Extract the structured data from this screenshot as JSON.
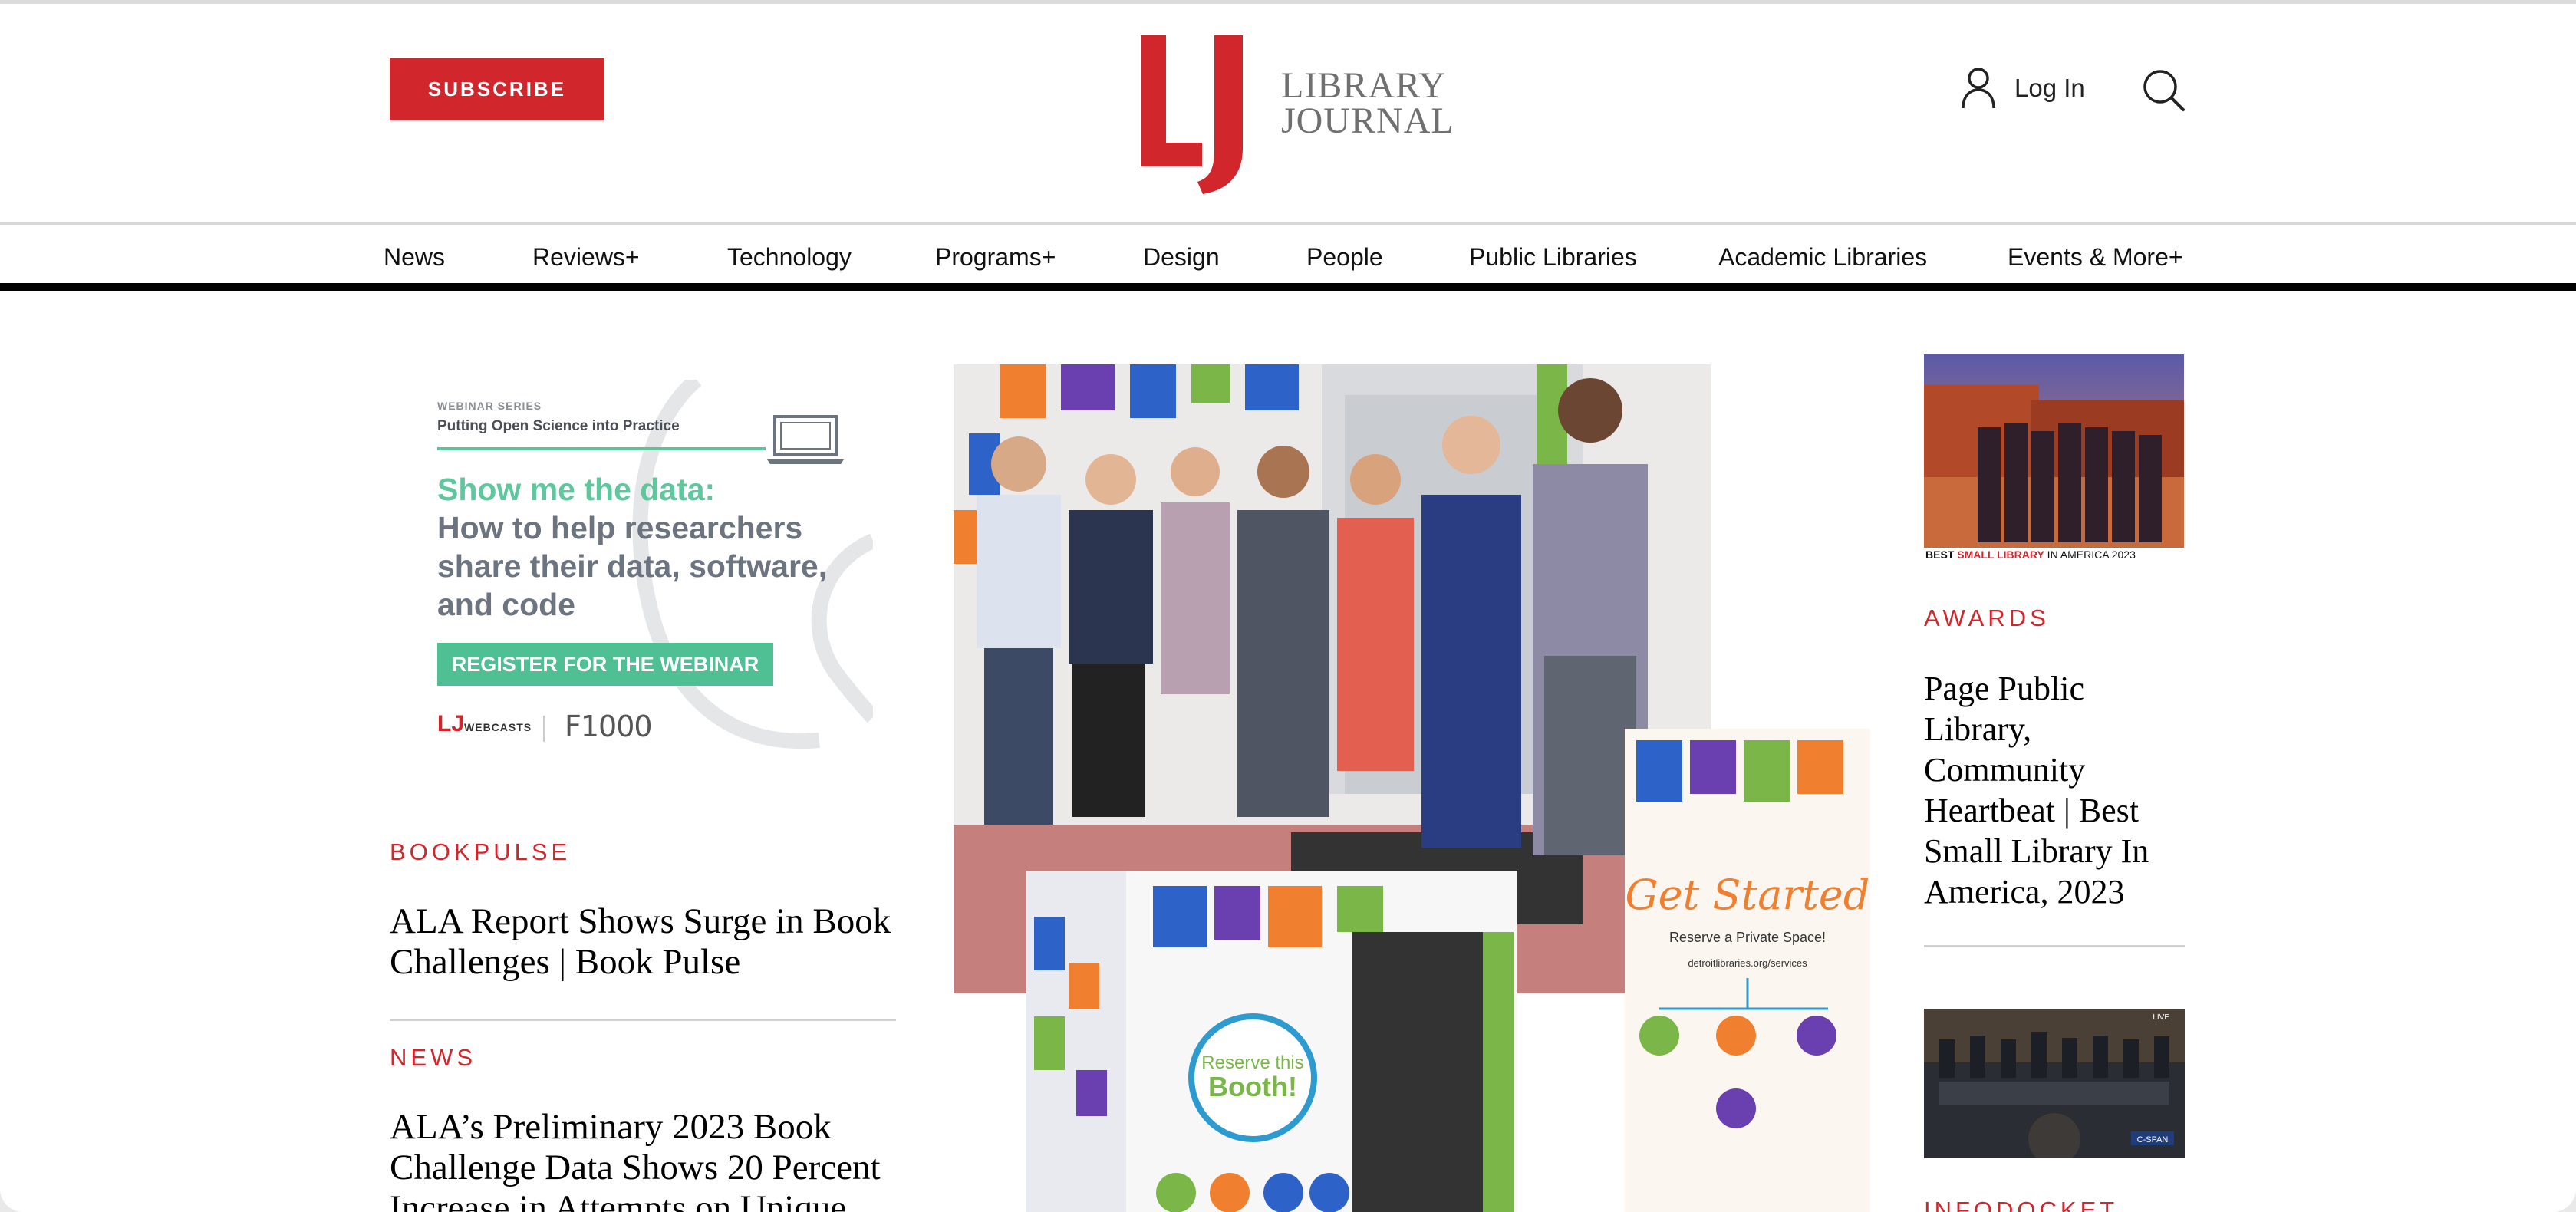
{
  "header": {
    "subscribe_label": "SUBSCRIBE",
    "logo_line1": "LIBRARY",
    "logo_line2": "JOURNAL",
    "login_label": "Log In"
  },
  "nav": {
    "items": [
      "News",
      "Reviews+",
      "Technology",
      "Programs+",
      "Design",
      "People",
      "Public Libraries",
      "Academic Libraries",
      "Events & More+"
    ]
  },
  "ad": {
    "series": "WEBINAR SERIES",
    "subtitle": "Putting Open Science into Practice",
    "headline": "Show me the data:",
    "body_lines": [
      "How to help researchers",
      "share their data, software,",
      "and code"
    ],
    "cta": "REGISTER FOR THE WEBINAR",
    "logo_lj": "LJ",
    "logo_lj_small": "WEBCASTS",
    "logo_partner": "F1000"
  },
  "left_articles": [
    {
      "kicker": "BOOKPULSE",
      "title_lines": [
        "ALA Report Shows Surge in Book",
        "Challenges | Book Pulse"
      ]
    },
    {
      "kicker": "NEWS",
      "title_lines": [
        "ALA’s Preliminary 2023 Book",
        "Challenge Data Shows 20 Percent",
        "Increase in Attempts on Unique"
      ]
    }
  ],
  "hero": {
    "banner_title": "Get Started",
    "banner_subtitle": "Reserve a Private Space!",
    "banner_url": "detroitlibraries.org/services",
    "booth_text_1": "Reserve this",
    "booth_text_2": "Booth!",
    "booth_side_text": "Reserve This Booth!"
  },
  "right_column": {
    "thumb1_caption_pre": "BEST ",
    "thumb1_caption_red": "SMALL LIBRARY",
    "thumb1_caption_post": " IN AMERICA 2023",
    "article1_kicker": "AWARDS",
    "article1_title_lines": [
      "Page Public",
      "Library,",
      "Community",
      "Heartbeat | Best",
      "Small Library In",
      "America, 2023"
    ],
    "thumb2_badge": "C-SPAN",
    "thumb2_live": "LIVE",
    "article2_kicker": "INFODOCKET"
  },
  "colors": {
    "brand_red": "#d0262c",
    "ad_green": "#4fbf94",
    "text": "#000000"
  },
  "icons": [
    "user-icon",
    "search-icon",
    "laptop-icon"
  ]
}
